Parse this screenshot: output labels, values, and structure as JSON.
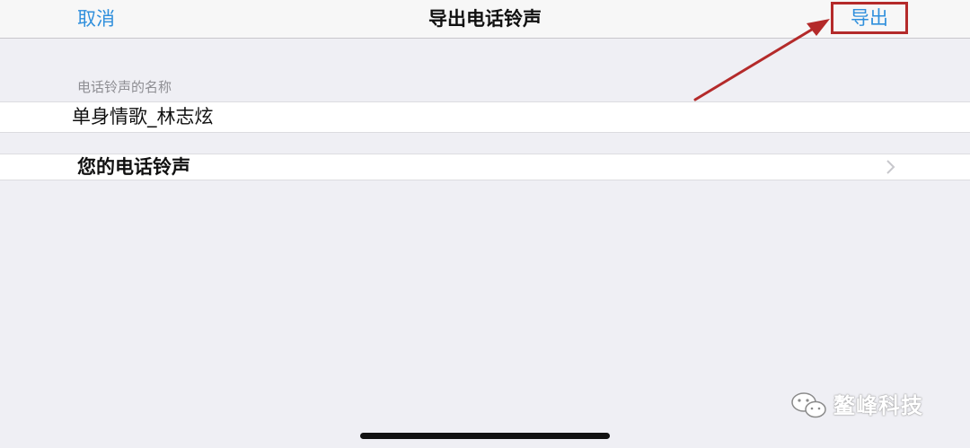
{
  "navbar": {
    "cancel_label": "取消",
    "title": "导出电话铃声",
    "export_label": "导出"
  },
  "name_section": {
    "header": "电话铃声的名称",
    "value": "单身情歌_林志炫"
  },
  "ringtone_row": {
    "label": "您的电话铃声",
    "icon": "chevron-right-icon"
  },
  "watermark": {
    "icon": "wechat-icon",
    "text": "鳌峰科技"
  },
  "colors": {
    "accent": "#2f8fdc",
    "annotation": "#b42a2a",
    "background": "#efeff4"
  }
}
